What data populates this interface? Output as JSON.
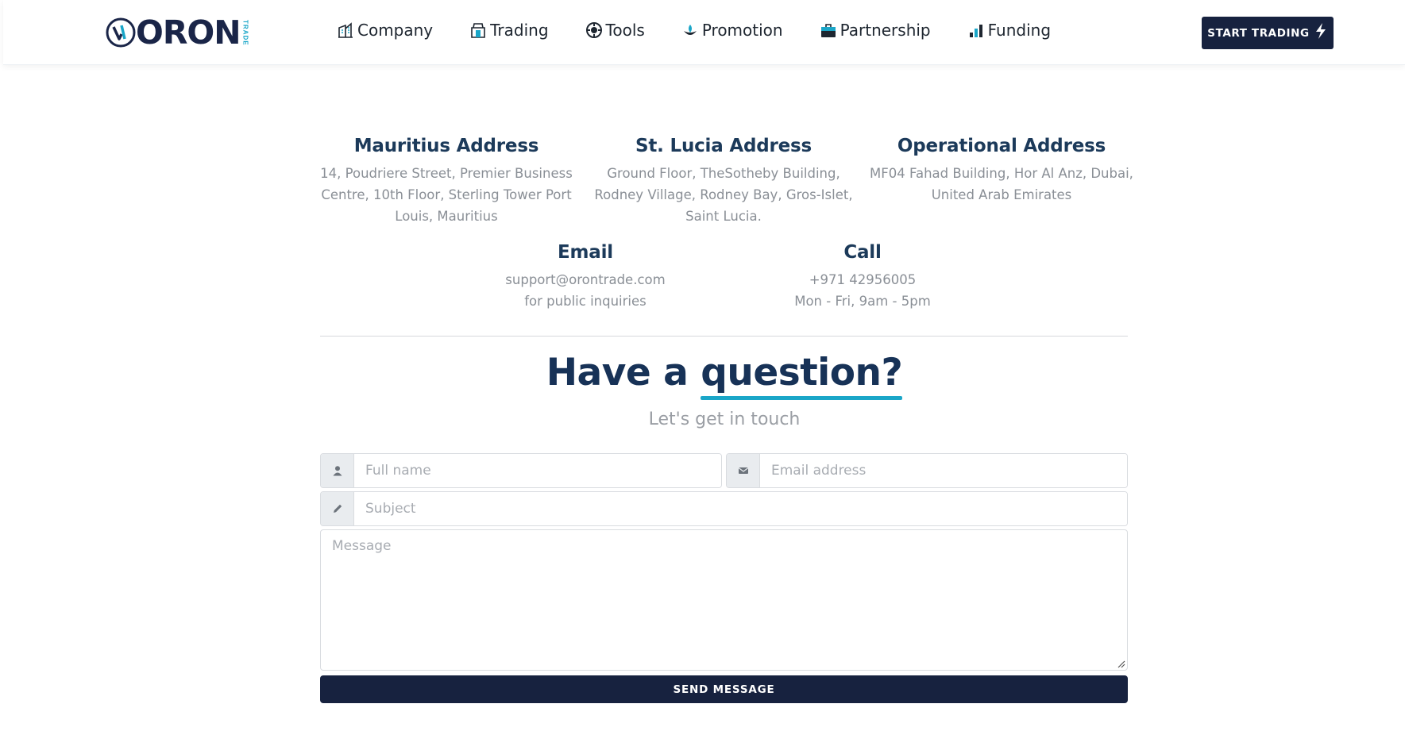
{
  "header": {
    "logo": {
      "text": "ORON",
      "subtext": "TRADE"
    },
    "nav": [
      {
        "label": "Company",
        "icon": "building-icon"
      },
      {
        "label": "Trading",
        "icon": "shop-icon"
      },
      {
        "label": "Tools",
        "icon": "gear-icon"
      },
      {
        "label": "Promotion",
        "icon": "lotus-icon"
      },
      {
        "label": "Partnership",
        "icon": "briefcase-icon"
      },
      {
        "label": "Funding",
        "icon": "bar-chart-icon"
      }
    ],
    "cta_label": "START TRADING"
  },
  "addresses": [
    {
      "title": "Mauritius Address",
      "text": "14, Poudriere Street, Premier Business Centre, 10th Floor, Sterling Tower Port Louis, Mauritius"
    },
    {
      "title": "St. Lucia Address",
      "text": "Ground Floor, TheSotheby Building, Rodney Village, Rodney Bay, Gros-Islet, Saint Lucia."
    },
    {
      "title": "Operational Address",
      "text": "MF04 Fahad Building, Hor Al Anz, Dubai, United Arab Emirates"
    }
  ],
  "contact": {
    "email_title": "Email",
    "email": "support@orontrade.com",
    "email_note": "for public inquiries",
    "call_title": "Call",
    "phone": "+971 42956005",
    "hours": "Mon - Fri, 9am - 5pm"
  },
  "headline": {
    "prefix": "Have a",
    "highlight": "question?"
  },
  "subline": "Let's get in touch",
  "form": {
    "name_placeholder": "Full name",
    "email_placeholder": "Email address",
    "subject_placeholder": "Subject",
    "message_placeholder": "Message",
    "submit_label": "SEND MESSAGE"
  },
  "colors": {
    "navy": "#17223f",
    "accent": "#1aa6c8",
    "heading": "#1c3a5a",
    "muted": "#8a8f96"
  }
}
